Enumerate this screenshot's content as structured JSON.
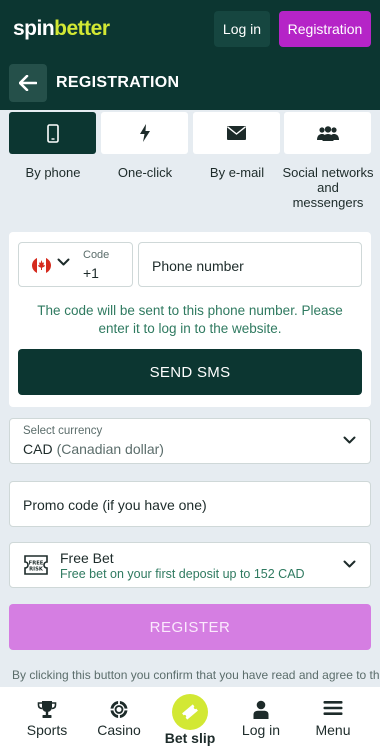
{
  "header": {
    "logo_part1": "spin",
    "logo_part2": "better",
    "login_label": "Log in",
    "registration_label": "Registration"
  },
  "page": {
    "title": "REGISTRATION"
  },
  "tabs": [
    {
      "label": "By phone",
      "icon": "phone-icon",
      "active": true
    },
    {
      "label": "One-click",
      "icon": "lightning-icon",
      "active": false
    },
    {
      "label": "By e-mail",
      "icon": "envelope-icon",
      "active": false
    },
    {
      "label": "Social networks and messengers",
      "icon": "people-icon",
      "active": false
    }
  ],
  "phone_form": {
    "code_label": "Code",
    "code_value": "+1",
    "country_flag": "canada-flag-icon",
    "phone_placeholder": "Phone number",
    "hint": "The code will be sent to this phone number. Please enter it to log in to the website.",
    "send_sms_label": "SEND SMS"
  },
  "currency": {
    "label": "Select currency",
    "code": "CAD",
    "name": "(Canadian dollar)"
  },
  "promo": {
    "placeholder": "Promo code (if you have one)"
  },
  "bonus": {
    "title": "Free Bet",
    "subtitle": "Free bet on your first deposit up to 152 CAD",
    "icon": "free-risk-ticket-icon"
  },
  "register_label": "REGISTER",
  "terms_text": "By clicking this button you confirm that you have read and agree to the",
  "bottom_nav": [
    {
      "label": "Sports",
      "icon": "trophy-icon"
    },
    {
      "label": "Casino",
      "icon": "casino-chip-icon"
    },
    {
      "label": "Bet slip",
      "icon": "ticket-icon"
    },
    {
      "label": "Log in",
      "icon": "user-icon"
    },
    {
      "label": "Menu",
      "icon": "menu-icon"
    }
  ],
  "colors": {
    "header_bg": "#0c3631",
    "brand_accent": "#d2e834",
    "registration_button": "#b524c7",
    "register_button": "#d57ee2",
    "hint_text": "#2f7a60"
  }
}
